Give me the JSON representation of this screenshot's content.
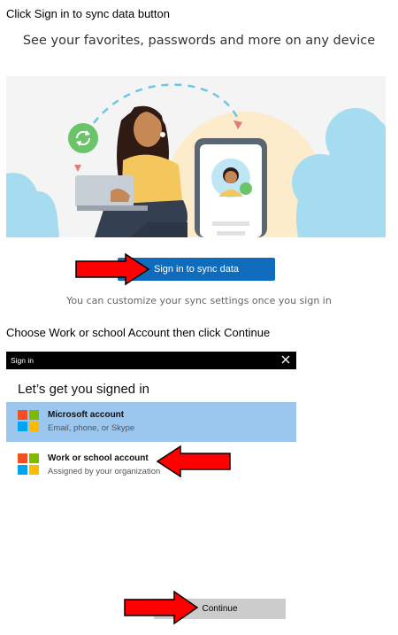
{
  "instructions": {
    "step1": "Click Sign in to sync data button",
    "step2": "Choose Work or school Account then click Continue"
  },
  "sync_promo": {
    "headline": "See your favorites, passwords and more on any device",
    "sign_in_button": "Sign in to sync data",
    "subtext": "You can customize your sync settings once you sign in"
  },
  "signin_dialog": {
    "window_title": "Sign in",
    "close_icon": "close-icon",
    "heading": "Let’s get you signed in",
    "accounts": [
      {
        "title": "Microsoft account",
        "subtitle": "Email, phone, or Skype",
        "selected": true
      },
      {
        "title": "Work or school account",
        "subtitle": "Assigned by your organization",
        "selected": false
      }
    ],
    "continue_button": "Continue"
  },
  "colors": {
    "accent_blue": "#0f6cbd",
    "selected_row": "#9bc6ee",
    "annotation_red": "#ff0000",
    "ms_red": "#f25022",
    "ms_green": "#7fba00",
    "ms_blue": "#00a4ef",
    "ms_yellow": "#ffb900"
  },
  "icons": [
    "sync-icon",
    "close-icon",
    "microsoft-logo-icon",
    "red-arrow-icon"
  ]
}
